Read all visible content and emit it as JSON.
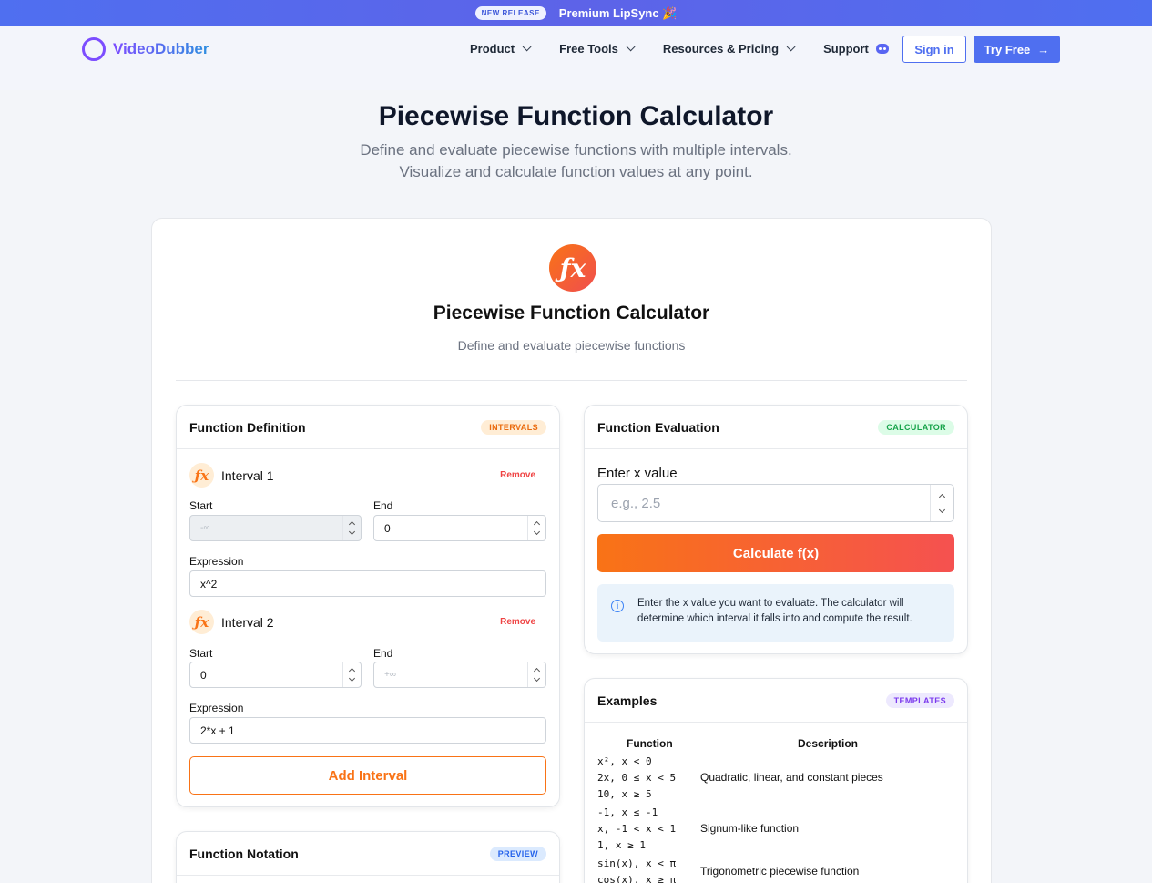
{
  "banner": {
    "pill": "NEW RELEASE",
    "text": "Premium LipSync 🎉"
  },
  "nav": {
    "brand": "VideoDubber",
    "items": [
      {
        "label": "Product"
      },
      {
        "label": "Free Tools"
      },
      {
        "label": "Resources & Pricing"
      },
      {
        "label": "Support"
      }
    ],
    "signin": "Sign in",
    "tryfree": "Try Free",
    "tryfree_arrow": "→"
  },
  "hero": {
    "title": "Piecewise Function Calculator",
    "subtitle_line1": "Define and evaluate piecewise functions with multiple intervals.",
    "subtitle_line2": "Visualize and calculate function values at any point."
  },
  "card": {
    "icon_glyph": "ƒx",
    "title": "Piecewise Function Calculator",
    "subtitle": "Define and evaluate piecewise functions"
  },
  "definition": {
    "title": "Function Definition",
    "badge": "INTERVALS",
    "intervals": [
      {
        "label": "Interval 1",
        "remove": "Remove",
        "start_label": "Start",
        "start_value": "",
        "start_placeholder": "-∞",
        "end_label": "End",
        "end_value": "0",
        "end_placeholder": "",
        "expression_label": "Expression",
        "expression": "x^2"
      },
      {
        "label": "Interval 2",
        "remove": "Remove",
        "start_label": "Start",
        "start_value": "0",
        "start_placeholder": "",
        "end_label": "End",
        "end_value": "",
        "end_placeholder": "+∞",
        "expression_label": "Expression",
        "expression": "2*x + 1"
      }
    ],
    "add_button": "Add Interval"
  },
  "evaluation": {
    "title": "Function Evaluation",
    "badge": "CALCULATOR",
    "input_label": "Enter x value",
    "input_placeholder": "e.g., 2.5",
    "calc_button": "Calculate f(x)",
    "info_icon": "i",
    "info_text": "Enter the x value you want to evaluate. The calculator will determine which interval it falls into and compute the result."
  },
  "examples": {
    "title": "Examples",
    "badge": "TEMPLATES",
    "col_function": "Function",
    "col_description": "Description",
    "rows": [
      {
        "lines": [
          "x², x < 0",
          "2x, 0 ≤ x < 5",
          "10, x ≥ 5"
        ],
        "description": "Quadratic, linear, and constant pieces"
      },
      {
        "lines": [
          "-1, x ≤ -1",
          "x, -1 < x < 1",
          "1, x ≥ 1"
        ],
        "description": "Signum-like function"
      },
      {
        "lines": [
          "sin(x), x < π",
          "cos(x), x ≥ π"
        ],
        "description": "Trigonometric piecewise function"
      }
    ]
  },
  "notation": {
    "title": "Function Notation",
    "badge": "PREVIEW"
  }
}
